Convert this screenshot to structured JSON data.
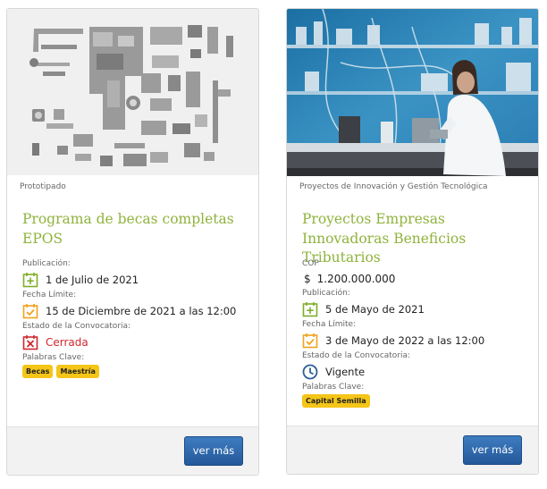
{
  "cards": [
    {
      "category": "Prototipado",
      "title": "Programa de becas completas EPOS",
      "publication_label": "Publicación:",
      "publication_value": "1 de Julio de 2021",
      "deadline_label": "Fecha Límite:",
      "deadline_value": "15 de Diciembre de 2021 a las 12:00",
      "status_label": "Estado de la Convocatoria:",
      "status_value": "Cerrada",
      "keywords_label": "Palabras Clave:",
      "keywords": [
        "Becas",
        "Maestría"
      ],
      "button_label": "ver más"
    },
    {
      "category": "Proyectos de Innovación y Gestión Tecnológica",
      "title": "Proyectos Empresas Innovadoras Beneficios Tributarios",
      "amount_label": "COP",
      "amount_currency": "$",
      "amount_value": "1.200.000.000",
      "publication_label": "Publicación:",
      "publication_value": "5 de Mayo de 2021",
      "deadline_label": "Fecha Límite:",
      "deadline_value": "3 de Mayo de 2022 a las 12:00",
      "status_label": "Estado de la Convocatoria:",
      "status_value": "Vigente",
      "keywords_label": "Palabras Clave:",
      "keywords": [
        "Capital Semilla"
      ],
      "button_label": "ver más"
    }
  ],
  "colors": {
    "title": "#8fb33d",
    "calendar_green": "#7fae2b",
    "calendar_orange": "#f0a21e",
    "closed_red": "#d0272d",
    "open_blue": "#2c5f93",
    "tag_yellow": "#f5c518",
    "button_blue": "#2d67aa"
  }
}
